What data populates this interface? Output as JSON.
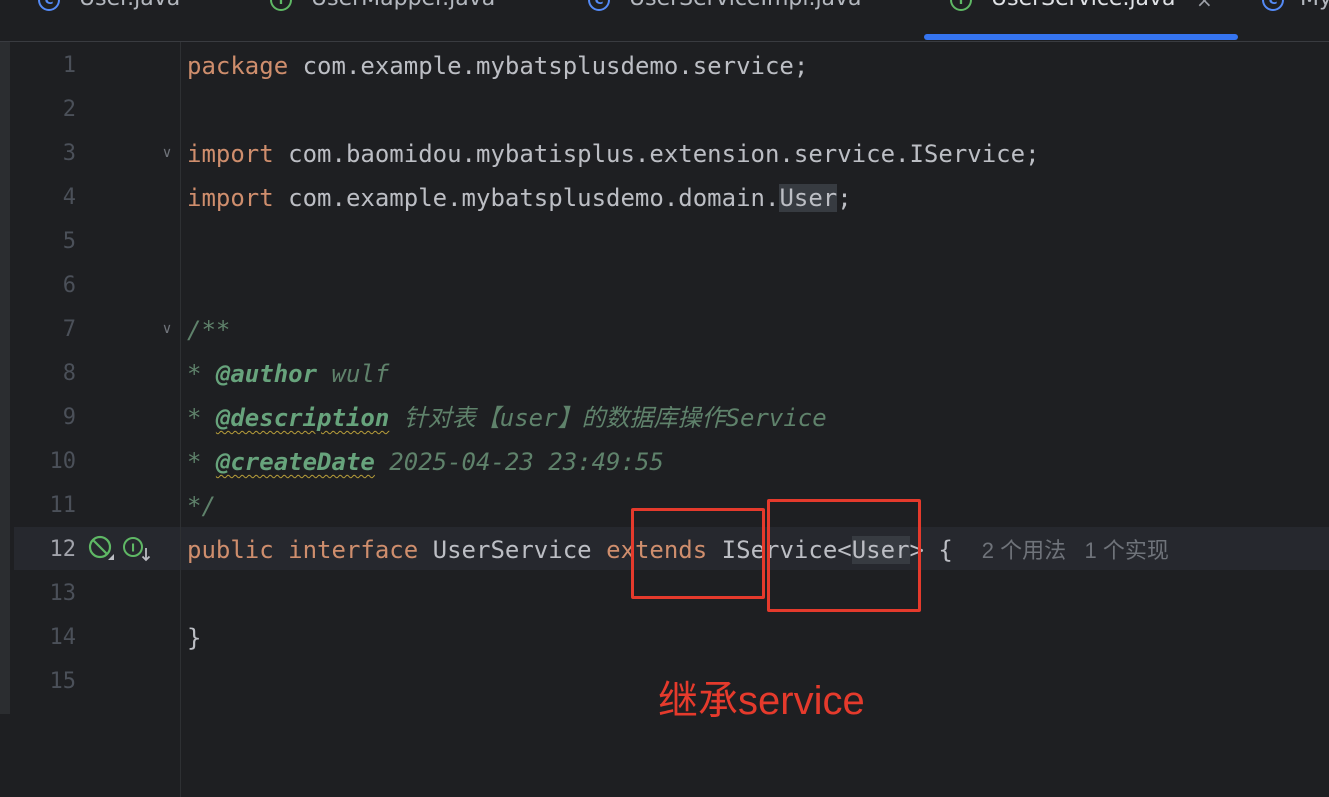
{
  "tabs": [
    {
      "label": "User.java",
      "icon": "class-icon",
      "icon_glyph": "C",
      "active": false
    },
    {
      "label": "UserMapper.java",
      "icon": "interface-icon",
      "icon_glyph": "I",
      "active": false
    },
    {
      "label": "UserServiceImpl.java",
      "icon": "class-icon",
      "icon_glyph": "C",
      "active": false
    },
    {
      "label": "UserService.java",
      "icon": "interface-icon",
      "icon_glyph": "I",
      "active": true,
      "close_glyph": "×"
    },
    {
      "label": "My",
      "icon": "class-icon",
      "icon_glyph": "C",
      "active": false
    }
  ],
  "editor": {
    "line_numbers": [
      "1",
      "2",
      "3",
      "4",
      "5",
      "6",
      "7",
      "8",
      "9",
      "10",
      "11",
      "12",
      "13",
      "14",
      "15"
    ],
    "current_line": "12",
    "fold_glyph": "∨",
    "code": {
      "l1": {
        "kw": "package",
        "rest": " com.example.mybatsplusdemo.service;"
      },
      "l3": {
        "kw": "import",
        "rest": " com.baomidou.mybatisplus.extension.service.IService;"
      },
      "l4": {
        "kw": "import",
        "pre": " com.example.mybatsplusdemo.domain.",
        "hl": "User",
        "post": ";"
      },
      "l7": {
        "text": "/**"
      },
      "l8": {
        "star": "* ",
        "tag": "@author",
        "text": " wulf"
      },
      "l9": {
        "star": "* ",
        "tag": "@description",
        "text": " 针对表【user】的数据库操作Service"
      },
      "l10": {
        "star": "* ",
        "tag": "@createDate",
        "text": " 2025-04-23 23:49:55"
      },
      "l11": {
        "text": "*/"
      },
      "l12": {
        "kw1": "public",
        "kw2": "interface",
        "name": "UserService",
        "kw3": "extends",
        "type": "IService",
        "lt": "<",
        "generic": "User",
        "gt": ">",
        "brace": "{",
        "usages": "2 个用法",
        "impls": "1 个实现"
      },
      "l14": {
        "text": "}"
      }
    }
  },
  "annotation": {
    "text": "继承service",
    "color": "#e53a2c"
  },
  "colors": {
    "background": "#1e1f22",
    "keyword": "#cf8e6d",
    "plain": "#bcbec4",
    "doc_comment": "#5f826b",
    "doc_tag": "#67a37c",
    "tab_accent": "#3574f0"
  }
}
